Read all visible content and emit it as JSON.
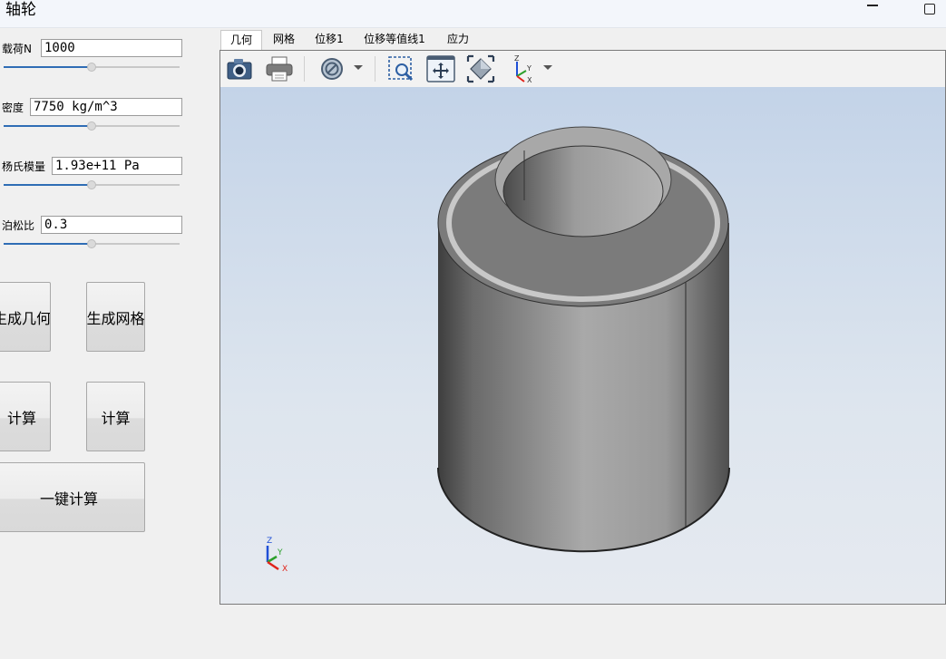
{
  "window": {
    "title": "轴轮"
  },
  "fields": {
    "load": {
      "label": "载荷N",
      "value": "1000",
      "slider": 0.5
    },
    "density": {
      "label": "密度",
      "value": "7750 kg/m^3",
      "slider": 0.5
    },
    "youngs": {
      "label": "杨氏模量",
      "value": "1.93e+11 Pa",
      "slider": 0.5
    },
    "poisson": {
      "label": "泊松比",
      "value": "0.3",
      "slider": 0.5
    }
  },
  "buttons": {
    "gen_geometry": "生成几何",
    "gen_mesh": "生成网格",
    "compute_left": "计算",
    "compute_right": "计算",
    "one_click": "一键计算"
  },
  "tabs": [
    {
      "label": "几何",
      "active": true
    },
    {
      "label": "网格",
      "active": false
    },
    {
      "label": "位移1",
      "active": false
    },
    {
      "label": "位移等值线1",
      "active": false
    },
    {
      "label": "应力",
      "active": false
    }
  ],
  "toolbar": {
    "icons": [
      "camera-icon",
      "print-icon",
      "clip-plane-icon",
      "zoom-box-icon",
      "pan-icon",
      "fit-all-icon",
      "axes-icon"
    ]
  },
  "triad": {
    "z": "Z",
    "y": "Y",
    "x": "X"
  },
  "colors": {
    "accent": "#2f6db5",
    "axis_x": "#e0231b",
    "axis_y": "#2ca02c",
    "axis_z": "#1f4fd6"
  }
}
